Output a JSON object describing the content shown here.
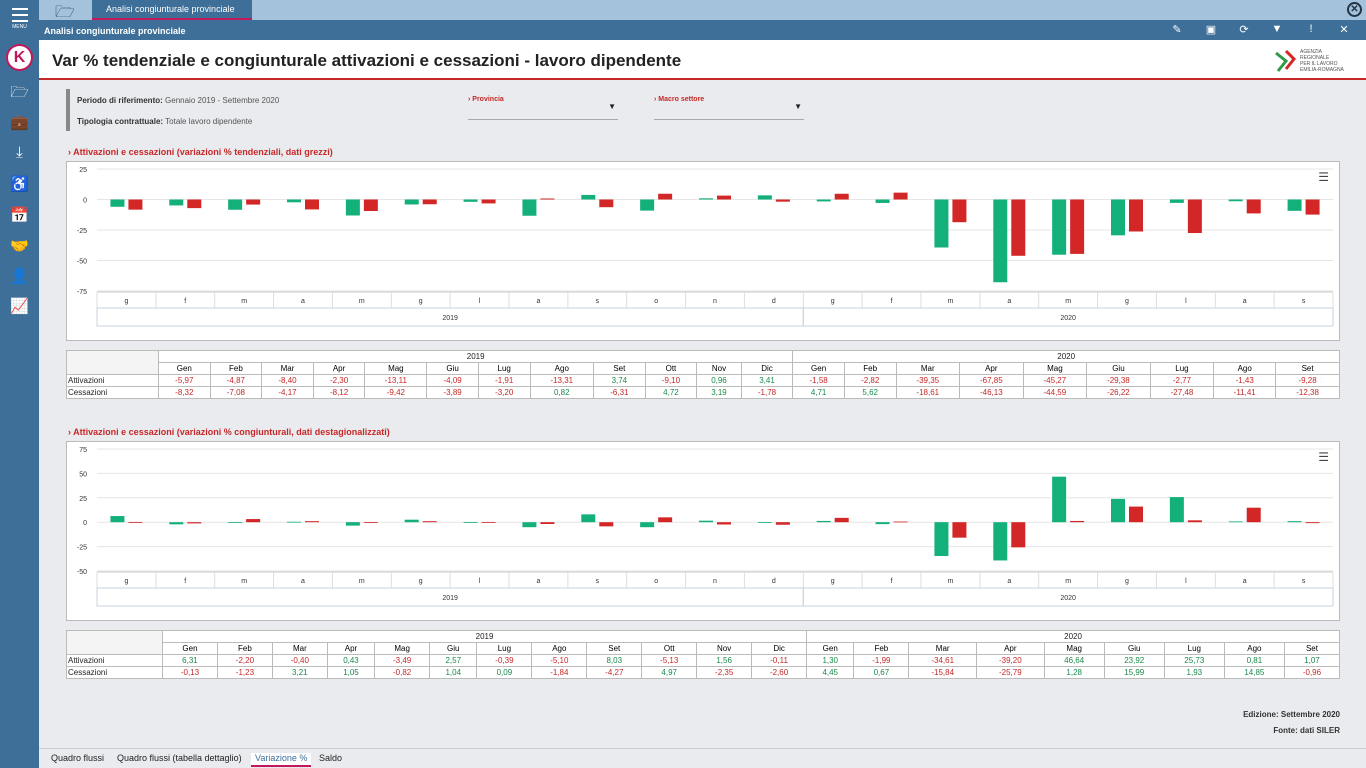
{
  "app": {
    "menu_label": "MENU",
    "top_tab": "Analisi congiunturale provinciale",
    "window_title": "Analisi congiunturale provinciale"
  },
  "header": {
    "title": "Var % tendenziale e congiunturale attivazioni e cessazioni - lavoro dipendente",
    "logo_text": [
      "AGENZIA",
      "REGIONALE",
      "PER IL LAVORO",
      "EMILIA-ROMAGNA"
    ]
  },
  "filters": {
    "periodo_label": "Periodo di riferimento:",
    "periodo_value": "Gennaio 2019 - Settembre 2020",
    "tipologia_label": "Tipologia contrattuale:",
    "tipologia_value": "Totale lavoro dipendente",
    "provincia_label": "Provincia",
    "macro_label": "Macro settore"
  },
  "section1": {
    "title": "Attivazioni e cessazioni (variazioni % tendenziali, dati grezzi)"
  },
  "section2": {
    "title": "Attivazioni e cessazioni (variazioni % congiunturali, dati destagionalizzati)"
  },
  "colors": {
    "attivazioni": "#13b07a",
    "cessazioni": "#d32626",
    "accent": "#c62828",
    "sidebar": "#3d6f98"
  },
  "icons": [
    "hamburger-menu-icon",
    "folder-icon",
    "briefcase-icon",
    "download-icon",
    "wheelchair-icon",
    "calendar-icon",
    "handshake-icon",
    "user-icon",
    "trend-chart-icon",
    "edit-icon",
    "save-icon",
    "refresh-icon",
    "filter-icon",
    "info-icon",
    "close-icon"
  ],
  "table": {
    "years": [
      "2019",
      "2020"
    ],
    "months2019": [
      "Gen",
      "Feb",
      "Mar",
      "Apr",
      "Mag",
      "Giu",
      "Lug",
      "Ago",
      "Set",
      "Ott",
      "Nov",
      "Dic"
    ],
    "months2020": [
      "Gen",
      "Feb",
      "Mar",
      "Apr",
      "Mag",
      "Giu",
      "Lug",
      "Ago",
      "Set"
    ],
    "row_labels": [
      "Attivazioni",
      "Cessazioni"
    ]
  },
  "chart_data": [
    {
      "type": "bar",
      "title": "Attivazioni e cessazioni (variazioni % tendenziali, dati grezzi)",
      "categories": [
        "g",
        "f",
        "m",
        "a",
        "m",
        "g",
        "l",
        "a",
        "s",
        "o",
        "n",
        "d",
        "g",
        "f",
        "m",
        "a",
        "m",
        "g",
        "l",
        "a",
        "s"
      ],
      "groups": [
        "2019",
        "2020"
      ],
      "ylim": [
        -75,
        25
      ],
      "yticks": [
        "25",
        "0",
        "-25",
        "-50",
        "-75"
      ],
      "series": [
        {
          "name": "Attivazioni",
          "values": [
            "-5,97",
            "-4,87",
            "-8,40",
            "-2,30",
            "-13,11",
            "-4,09",
            "-1,91",
            "-13,31",
            "3,74",
            "-9,10",
            "0,96",
            "3,41",
            "-1,58",
            "-2,82",
            "-39,35",
            "-67,85",
            "-45,27",
            "-29,38",
            "-2,77",
            "-1,43",
            "-9,28"
          ]
        },
        {
          "name": "Cessazioni",
          "values": [
            "-8,32",
            "-7,08",
            "-4,17",
            "-8,12",
            "-9,42",
            "-3,89",
            "-3,20",
            "0,82",
            "-6,31",
            "4,72",
            "3,19",
            "-1,78",
            "4,71",
            "5,62",
            "-18,61",
            "-46,13",
            "-44,59",
            "-26,22",
            "-27,48",
            "-11,41",
            "-12,38"
          ]
        }
      ]
    },
    {
      "type": "bar",
      "title": "Attivazioni e cessazioni (variazioni % congiunturali, dati destagionalizzati)",
      "categories": [
        "g",
        "f",
        "m",
        "a",
        "m",
        "g",
        "l",
        "a",
        "s",
        "o",
        "n",
        "d",
        "g",
        "f",
        "m",
        "a",
        "m",
        "g",
        "l",
        "a",
        "s"
      ],
      "groups": [
        "2019",
        "2020"
      ],
      "ylim": [
        -50,
        75
      ],
      "yticks": [
        "75",
        "50",
        "25",
        "0",
        "-25",
        "-50"
      ],
      "series": [
        {
          "name": "Attivazioni",
          "values": [
            "6,31",
            "-2,20",
            "-0,40",
            "0,43",
            "-3,49",
            "2,57",
            "-0,39",
            "-5,10",
            "8,03",
            "-5,13",
            "1,56",
            "-0,11",
            "1,30",
            "-1,99",
            "-34,61",
            "-39,20",
            "46,64",
            "23,92",
            "25,73",
            "0,81",
            "1,07"
          ]
        },
        {
          "name": "Cessazioni",
          "values": [
            "-0,13",
            "-1,23",
            "3,21",
            "1,05",
            "-0,82",
            "1,04",
            "0,09",
            "-1,84",
            "-4,27",
            "4,97",
            "-2,35",
            "-2,60",
            "4,45",
            "0,67",
            "-15,84",
            "-25,79",
            "1,28",
            "15,99",
            "1,93",
            "14,85",
            "-0,96"
          ]
        }
      ]
    }
  ],
  "footer": {
    "edition": "Edizione: Settembre 2020",
    "source": "Fonte: dati SILER"
  },
  "bottom_tabs": [
    "Quadro flussi",
    "Quadro flussi (tabella dettaglio)",
    "Variazione %",
    "Saldo"
  ]
}
